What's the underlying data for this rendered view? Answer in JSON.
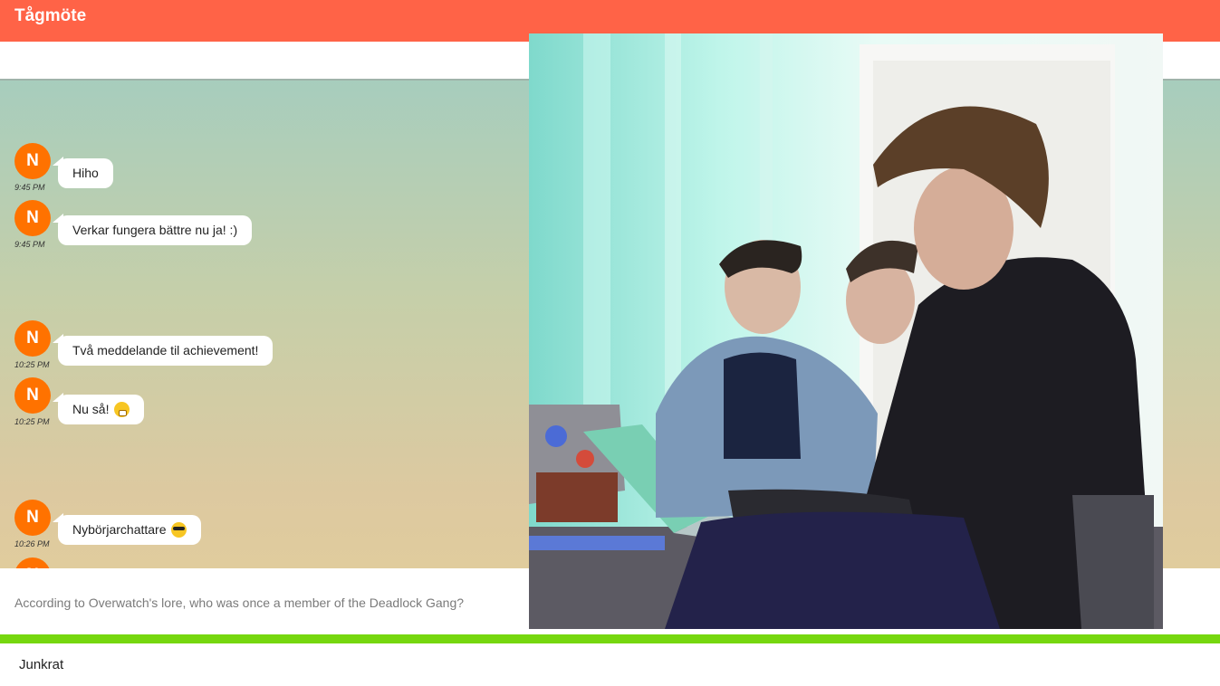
{
  "app": {
    "title": "Tågmöte"
  },
  "messages": [
    {
      "avatar": "N",
      "time": "9:45 PM",
      "text": "Hiho",
      "emoji": ""
    },
    {
      "avatar": "N",
      "time": "9:45 PM",
      "text": "Verkar fungera bättre nu ja! :)",
      "emoji": ""
    },
    {
      "avatar": "N",
      "time": "10:25 PM",
      "text": "Två meddelande til achievement!",
      "emoji": ""
    },
    {
      "avatar": "N",
      "time": "10:25 PM",
      "text": "Nu så!",
      "emoji": "surprised-face-emoji"
    },
    {
      "avatar": "N",
      "time": "10:26 PM",
      "text": "Nybörjarchattare",
      "emoji": "sunglasses-face-emoji"
    },
    {
      "avatar": "N",
      "time": "",
      "text": "",
      "emoji": ""
    }
  ],
  "question": {
    "text": "According to Overwatch's lore, who was once a member of the Deadlock Gang?"
  },
  "answer": {
    "value": "Junkrat"
  },
  "colors": {
    "app_bar": "#ff6347",
    "avatar": "#ff7200",
    "answer_bar": "#76d70f"
  }
}
